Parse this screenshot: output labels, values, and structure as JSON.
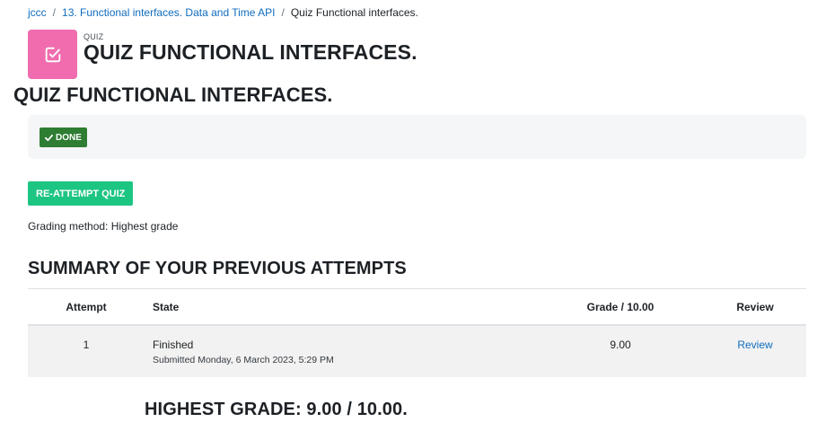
{
  "breadcrumb": {
    "items": [
      "jccc",
      "13. Functional interfaces. Data and Time API"
    ],
    "current": "Quiz Functional interfaces.",
    "separator": "/"
  },
  "header": {
    "activity_type": "QUIZ",
    "title": "QUIZ FUNCTIONAL INTERFACES.",
    "icon": "checkbox-icon",
    "icon_color": "#f06cae"
  },
  "quiz_heading": "QUIZ FUNCTIONAL INTERFACES.",
  "completion": {
    "badge_label": "DONE",
    "badge_icon": "check-icon",
    "badge_color": "#2e7d32"
  },
  "reattempt_label": "RE-ATTEMPT QUIZ",
  "grading_method": "Grading method: Highest grade",
  "summary_title": "SUMMARY OF YOUR PREVIOUS ATTEMPTS",
  "table": {
    "headers": {
      "attempt": "Attempt",
      "state": "State",
      "grade": "Grade / 10.00",
      "review": "Review"
    },
    "rows": [
      {
        "attempt": "1",
        "state": "Finished",
        "submitted": "Submitted Monday, 6 March 2023, 5:29 PM",
        "grade": "9.00",
        "review": "Review"
      }
    ]
  },
  "highest_grade": "HIGHEST GRADE: 9.00 / 10.00."
}
